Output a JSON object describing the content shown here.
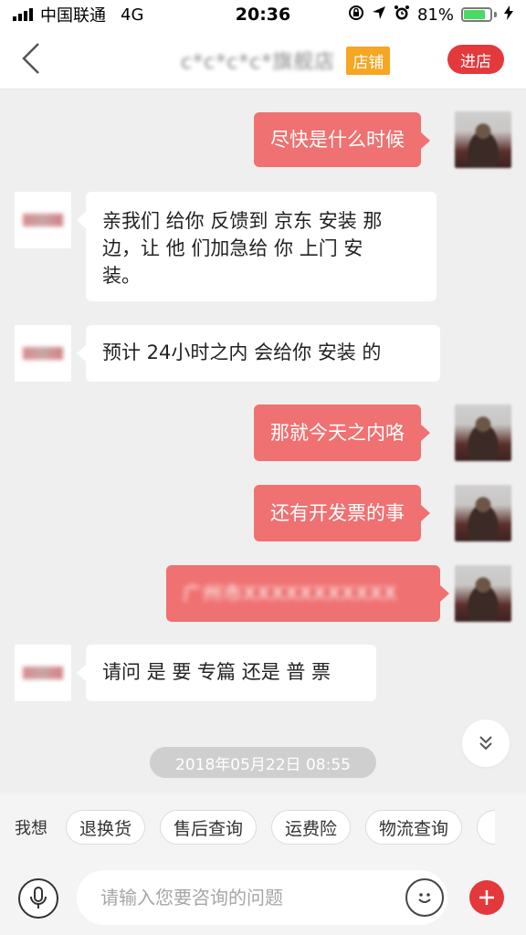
{
  "status_bar": {
    "carrier": "中国联通",
    "network": "4G",
    "time": "20:36",
    "battery_percent": "81%",
    "battery_level": 0.81
  },
  "header": {
    "shop_name": "c*c*c*c*旗舰店",
    "shop_tag": "店铺",
    "enter_label": "进店"
  },
  "messages": [
    {
      "from": "me",
      "text": "尽快是什么时候"
    },
    {
      "from": "shop",
      "lines": [
        "亲我们 给你 反馈到 京东 安装 那",
        "边，让 他 们加急给 你 上门 安",
        "装。"
      ]
    },
    {
      "from": "shop",
      "lines": [
        "预计 24小时之内 会给你 安装 的"
      ]
    },
    {
      "from": "me",
      "text": "那就今天之内咯"
    },
    {
      "from": "me",
      "text": "还有开发票的事"
    },
    {
      "from": "me",
      "text": "广州市XXXXXXXXXXX"
    },
    {
      "from": "shop",
      "lines": [
        "请问 是 要 专篇 还是 普 票"
      ]
    }
  ],
  "timestamp": "2018年05月22日 08:55",
  "quick": {
    "label": "我想",
    "chips": [
      "退换货",
      "售后查询",
      "运费险",
      "物流查询"
    ]
  },
  "input": {
    "placeholder": "请输入您要咨询的问题"
  },
  "colors": {
    "accent": "#e4393c",
    "bubble_mine": "#ef7171",
    "tag": "#f5a623"
  }
}
